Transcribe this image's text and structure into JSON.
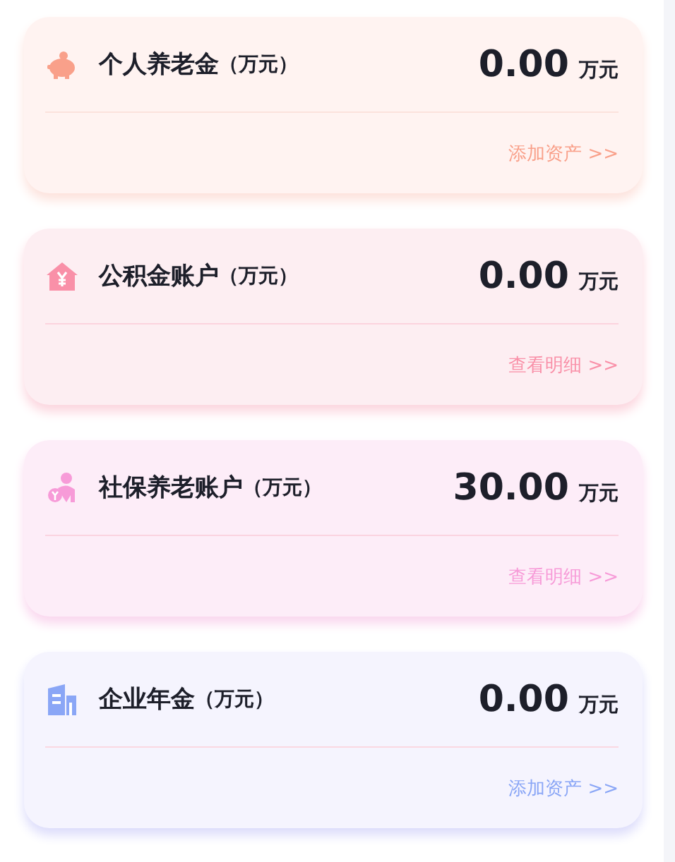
{
  "accounts": [
    {
      "kind": "piggy",
      "color": "#f9a08a",
      "title": "个人养老金",
      "title_unit": "（万元）",
      "amount": "0.00",
      "amount_unit": "万元",
      "link": "添加资产 >>"
    },
    {
      "kind": "house",
      "color": "#f990a8",
      "title": "公积金账户",
      "title_unit": "（万元）",
      "amount": "0.00",
      "amount_unit": "万元",
      "link": "查看明细 >>"
    },
    {
      "kind": "person",
      "color": "#f79bd8",
      "title": "社保养老账户",
      "title_unit": "（万元）",
      "amount": "30.00",
      "amount_unit": "万元",
      "link": "查看明细 >>"
    },
    {
      "kind": "building",
      "color": "#8aa6f6",
      "title": "企业年金",
      "title_unit": "（万元）",
      "amount": "0.00",
      "amount_unit": "万元",
      "link": "添加资产 >>"
    }
  ]
}
